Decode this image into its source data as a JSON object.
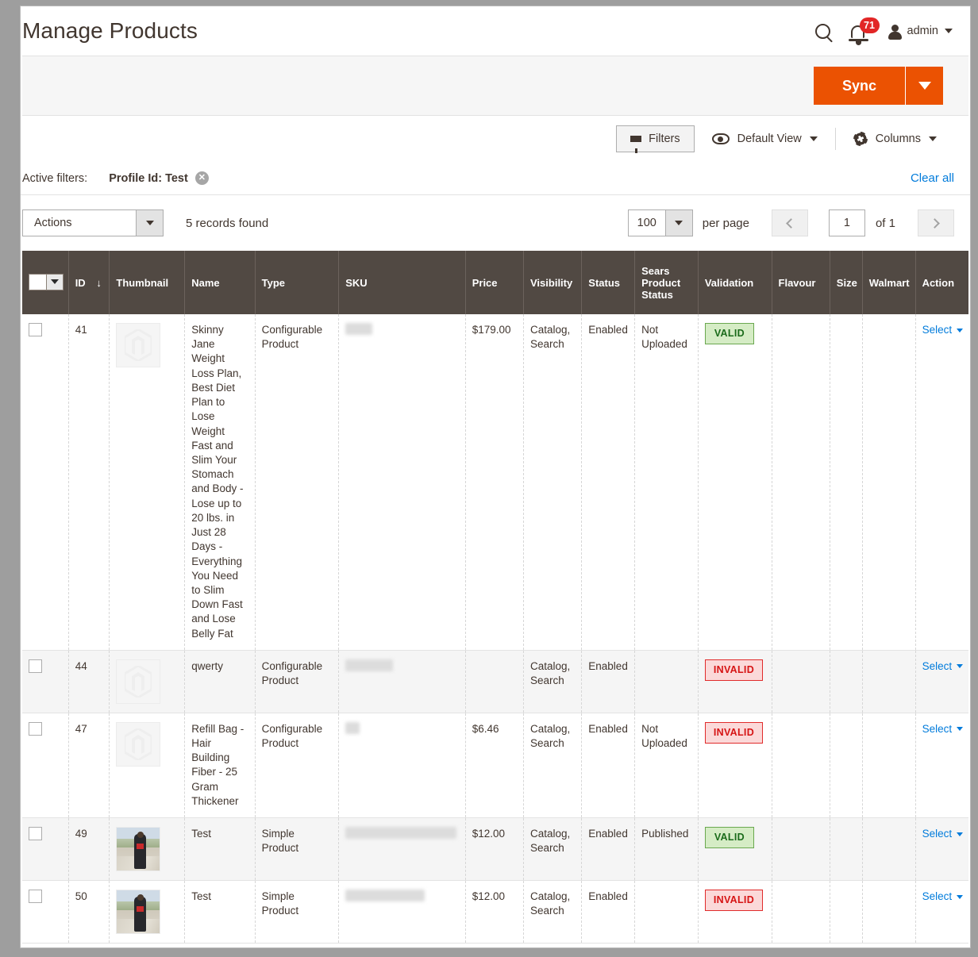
{
  "header": {
    "title": "Manage Products",
    "search_icon": "search-icon",
    "bell_icon": "notification-bell-icon",
    "notification_count": "71",
    "user_name": "admin"
  },
  "sync_bar": {
    "sync_label": "Sync",
    "sync_dropdown_icon": "chevron-down-icon"
  },
  "grid_tools": {
    "filters_label": "Filters",
    "filters_icon": "funnel-icon",
    "view_icon": "eye-icon",
    "view_label": "Default View",
    "columns_icon": "gear-icon",
    "columns_label": "Columns"
  },
  "active_filters": {
    "label": "Active filters:",
    "chips": [
      {
        "text": "Profile Id: Test",
        "remove_icon": "close-circle-icon"
      }
    ],
    "clear_all_label": "Clear all"
  },
  "grid_bar": {
    "actions_label": "Actions",
    "records_found": "5 records found",
    "per_page_value": "100",
    "per_page_label": "per page",
    "prev_icon": "chevron-left-icon",
    "next_icon": "chevron-right-icon",
    "page_value": "1",
    "page_total": "of 1"
  },
  "table": {
    "columns": [
      "",
      "ID",
      "Thumbnail",
      "Name",
      "Type",
      "SKU",
      "Price",
      "Visibility",
      "Status",
      "Sears Product Status",
      "Validation",
      "Flavour",
      "Size",
      "Walmart",
      "Action"
    ],
    "sort_column": "ID",
    "sort_direction_icon": "arrow-down-icon",
    "action_label": "Select",
    "rows": [
      {
        "id": "41",
        "thumbnail": "placeholder",
        "name": "Skinny Jane Weight Loss Plan, Best Diet Plan to Lose Weight Fast and Slim Your Stomach and Body - Lose up to 20 lbs. in Just 28 Days - Everything You Need to Slim Down Fast and Lose Belly Fat",
        "type": "Configurable Product",
        "sku": "",
        "sku_redacted_width": 34,
        "price": "$179.00",
        "visibility": "Catalog, Search",
        "status": "Enabled",
        "sears_product_status": "Not Uploaded",
        "validation": "VALID",
        "flavour": "",
        "size": "",
        "walmart": ""
      },
      {
        "id": "44",
        "thumbnail": "placeholder",
        "name": "qwerty",
        "type": "Configurable Product",
        "sku": "",
        "sku_redacted_width": 60,
        "price": "",
        "visibility": "Catalog, Search",
        "status": "Enabled",
        "sears_product_status": "",
        "validation": "INVALID",
        "flavour": "",
        "size": "",
        "walmart": ""
      },
      {
        "id": "47",
        "thumbnail": "placeholder",
        "name": "Refill Bag - Hair Building Fiber - 25 Gram Thickener",
        "type": "Configurable Product",
        "sku": "",
        "sku_redacted_width": 18,
        "price": "$6.46",
        "visibility": "Catalog, Search",
        "status": "Enabled",
        "sears_product_status": "Not Uploaded",
        "validation": "INVALID",
        "flavour": "",
        "size": "",
        "walmart": ""
      },
      {
        "id": "49",
        "thumbnail": "photo",
        "name": "Test",
        "type": "Simple Product",
        "sku": "",
        "sku_redacted_width": 140,
        "price": "$12.00",
        "visibility": "Catalog, Search",
        "status": "Enabled",
        "sears_product_status": "Published",
        "validation": "VALID",
        "flavour": "",
        "size": "",
        "walmart": ""
      },
      {
        "id": "50",
        "thumbnail": "photo",
        "name": "Test",
        "type": "Simple Product",
        "sku": "",
        "sku_redacted_width": 100,
        "price": "$12.00",
        "visibility": "Catalog, Search",
        "status": "Enabled",
        "sears_product_status": "",
        "validation": "INVALID",
        "flavour": "",
        "size": "",
        "walmart": ""
      }
    ]
  },
  "colors": {
    "accent_orange": "#eb5202",
    "header_brown": "#514943",
    "link_blue": "#007bdb",
    "valid_green": "#6aa84f",
    "invalid_red": "#e02b2b",
    "badge_red": "#e22626"
  }
}
